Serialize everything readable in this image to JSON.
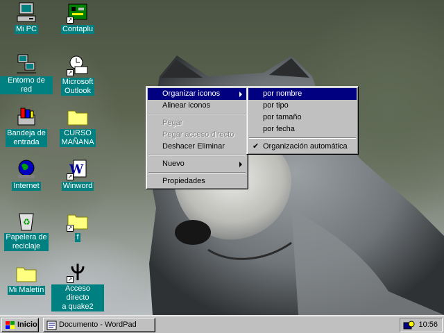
{
  "desktop": {
    "icons": [
      {
        "label": "Mi PC",
        "icon": "computer-icon"
      },
      {
        "label": "Contaplu",
        "icon": "circuit-board-icon"
      },
      {
        "label": "Entorno de red",
        "icon": "network-icon"
      },
      {
        "label": "Microsoft Outlook",
        "label_lines": [
          "Microsoft",
          "Outlook"
        ],
        "icon": "outlook-icon"
      },
      {
        "label_lines": [
          "Bandeja de",
          "entrada"
        ],
        "icon": "inbox-icon"
      },
      {
        "label_lines": [
          "CURSO",
          "MAÑANA"
        ],
        "icon": "folder-icon"
      },
      {
        "label": "Internet",
        "icon": "globe-icon"
      },
      {
        "label": "Winword",
        "icon": "word-icon"
      },
      {
        "label_lines": [
          "Papelera de",
          "reciclaje"
        ],
        "icon": "recycle-bin-icon"
      },
      {
        "label": "f",
        "icon": "folder-icon"
      },
      {
        "label": "Mi Maletín",
        "icon": "briefcase-icon"
      },
      {
        "label_lines": [
          "Acceso directo",
          "a quake2"
        ],
        "icon": "quake-icon"
      }
    ]
  },
  "context_menu": {
    "items": [
      {
        "label": "Organizar iconos",
        "has_submenu": true,
        "active": true,
        "enabled": true
      },
      {
        "label": "Alinear iconos",
        "enabled": true
      },
      {
        "separator": true
      },
      {
        "label": "Pegar",
        "enabled": false
      },
      {
        "label": "Pegar acceso directo",
        "enabled": false
      },
      {
        "label": "Deshacer Eliminar",
        "enabled": true
      },
      {
        "separator": true
      },
      {
        "label": "Nuevo",
        "has_submenu": true,
        "enabled": true
      },
      {
        "separator": true
      },
      {
        "label": "Propiedades",
        "enabled": true
      }
    ]
  },
  "submenu": {
    "items": [
      {
        "label": "por nombre",
        "active": true
      },
      {
        "label": "por tipo"
      },
      {
        "label": "por tamaño"
      },
      {
        "label": "por fecha"
      },
      {
        "separator": true
      },
      {
        "label": "Organización automática",
        "checked": true
      }
    ]
  },
  "taskbar": {
    "start_label": "Inicio",
    "tasks": [
      {
        "label": "Documento - WordPad",
        "icon": "wordpad-icon"
      }
    ],
    "clock": "10:56"
  },
  "colors": {
    "selection": "#000080",
    "icon_label_bg": "#008080",
    "face": "#c0c0c0"
  }
}
